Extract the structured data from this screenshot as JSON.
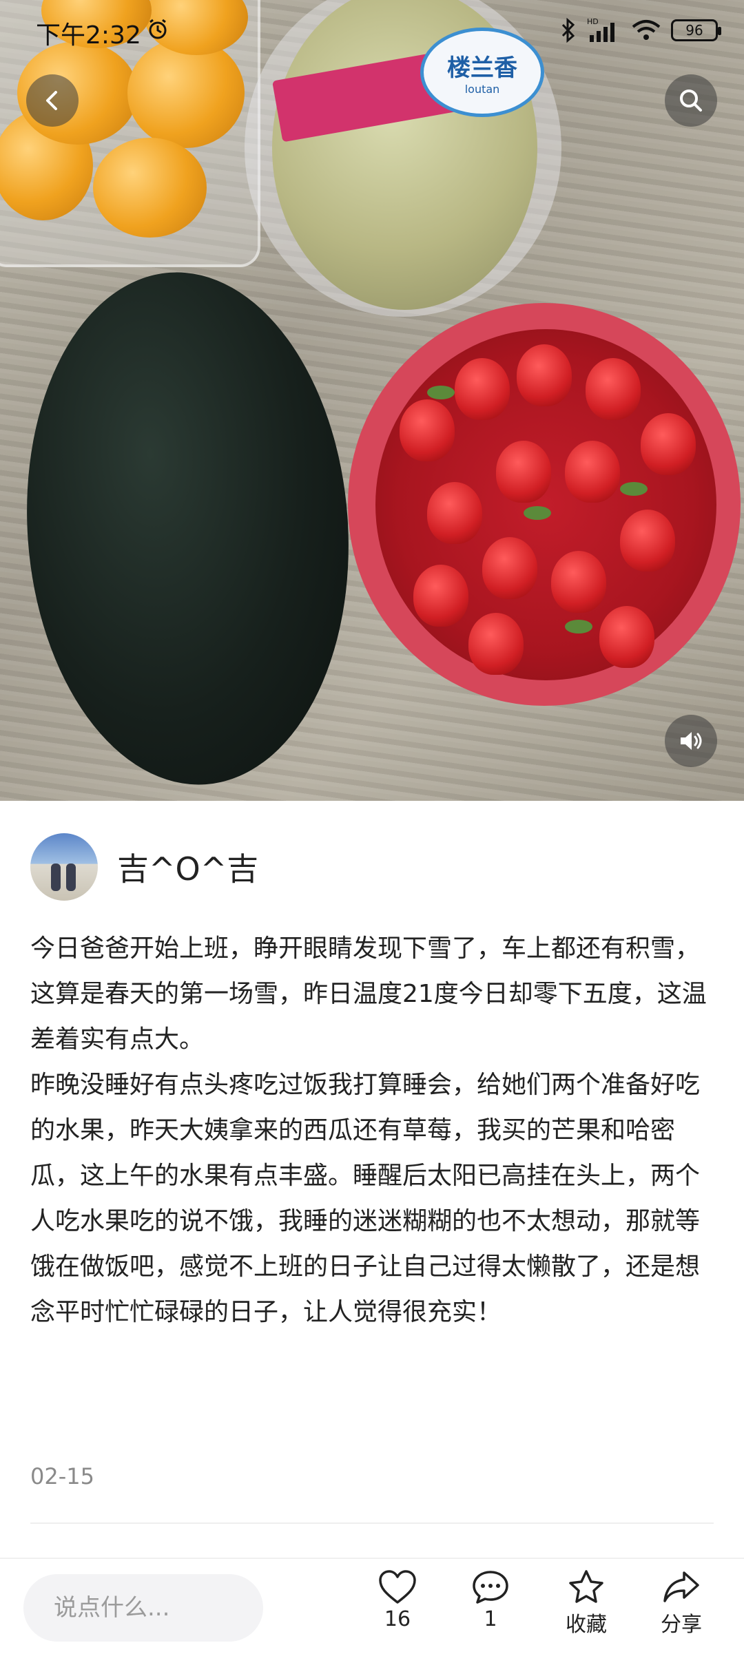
{
  "status_bar": {
    "time": "下午2:32",
    "battery": "96"
  },
  "photo": {
    "melon_label": "楼兰香",
    "melon_label_sub": "loutan",
    "icons": [
      "back-icon",
      "search-icon",
      "volume-icon"
    ]
  },
  "author": {
    "name": "吉^O^吉"
  },
  "post": {
    "body": "今日爸爸开始上班，睁开眼睛发现下雪了，车上都还有积雪，这算是春天的第一场雪，昨日温度21度今日却零下五度，这温差着实有点大。\n昨晚没睡好有点头疼吃过饭我打算睡会，给她们两个准备好吃的水果，昨天大姨拿来的西瓜还有草莓，我买的芒果和哈密瓜，这上午的水果有点丰盛。睡醒后太阳已高挂在头上，两个人吃水果吃的说不饿，我睡的迷迷糊糊的也不太想动，那就等饿在做饭吧，感觉不上班的日子让自己过得太懒散了，还是想念平时忙忙碌碌的日子，让人觉得很充实！",
    "date": "02-15"
  },
  "bottom_bar": {
    "comment_placeholder": "说点什么...",
    "like_count": "16",
    "comment_count": "1",
    "collect_label": "收藏",
    "share_label": "分享"
  }
}
